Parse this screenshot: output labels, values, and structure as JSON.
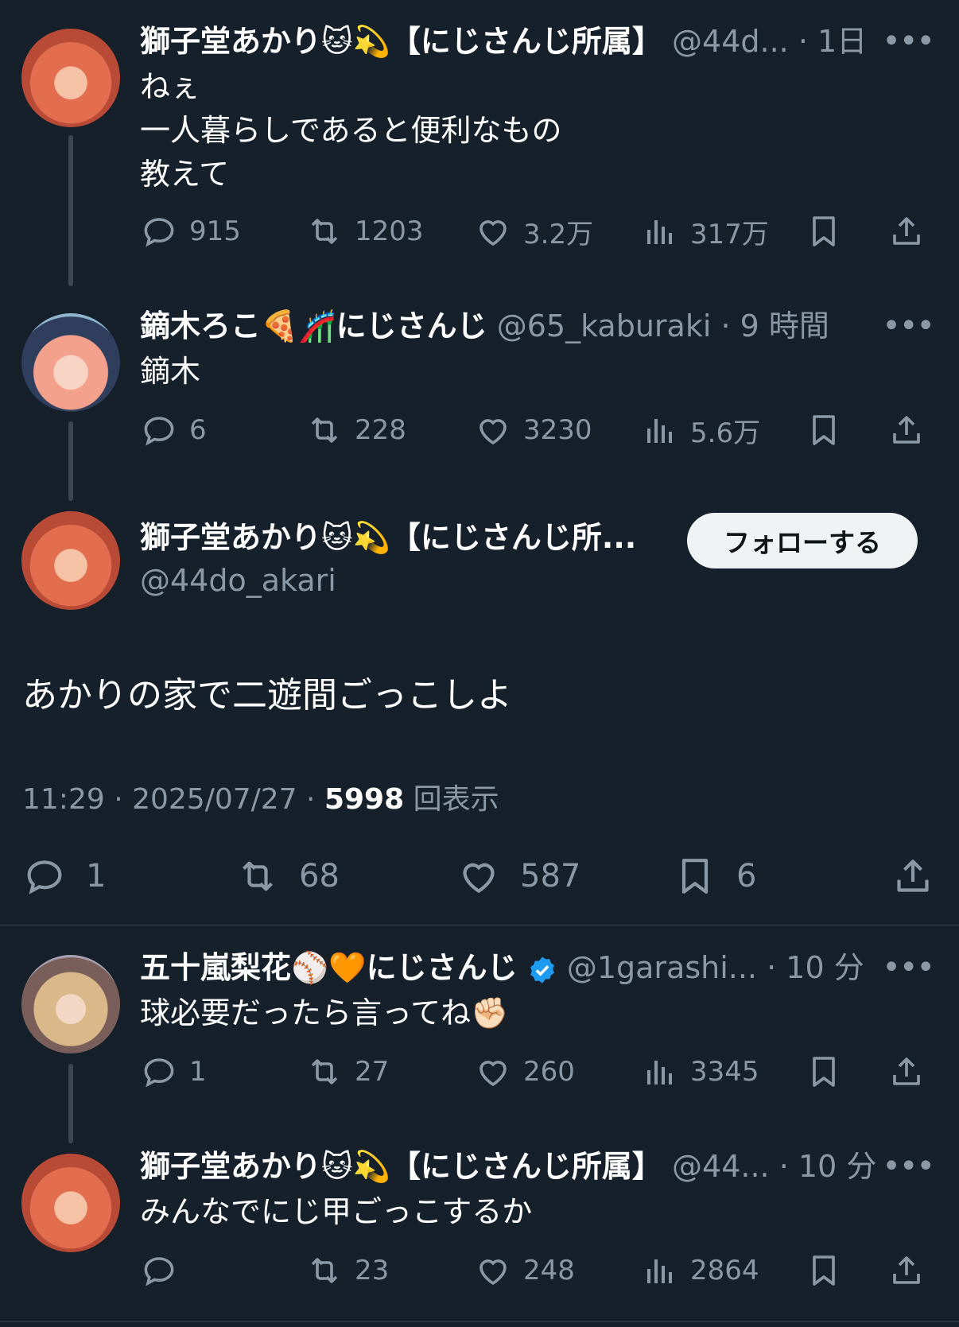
{
  "tweet1": {
    "display_name": "獅子堂あかり🐱💫【にじさんじ所属】",
    "handle": "@44d...",
    "time": "1日",
    "text": "ねぇ\n一人暮らしであると便利なもの\n教えて",
    "replies": "915",
    "retweets": "1203",
    "likes": "3.2万",
    "views": "317万"
  },
  "tweet2": {
    "display_name": "鏑木ろこ🍕🎢にじさんじ",
    "handle": "@65_kaburaki",
    "time": "9 時間",
    "text": "鏑木",
    "replies": "6",
    "retweets": "228",
    "likes": "3230",
    "views": "5.6万"
  },
  "main": {
    "display_name": "獅子堂あかり🐱💫【にじさんじ所...",
    "handle": "@44do_akari",
    "follow_label": "フォローする",
    "text": "あかりの家で二遊間ごっこしよ",
    "time": "11:29",
    "date": "2025/07/27",
    "views_count": "5998",
    "views_label": "回表示",
    "replies": "1",
    "retweets": "68",
    "likes": "587",
    "bookmarks": "6"
  },
  "reply1": {
    "display_name": "五十嵐梨花⚾🧡にじさんじ",
    "handle": "@1garashi...",
    "time": "10 分",
    "text": "球必要だったら言ってね✊🏻",
    "replies": "1",
    "retweets": "27",
    "likes": "260",
    "views": "3345"
  },
  "reply2": {
    "display_name": "獅子堂あかり🐱💫【にじさんじ所属】",
    "handle": "@44...",
    "time": "10 分",
    "text": "みんなでにじ甲ごっこするか",
    "replies": "",
    "retweets": "23",
    "likes": "248",
    "views": "2864"
  },
  "colors": {
    "background": "#15202b",
    "muted": "#8b98a5",
    "verified": "#1d9bf0"
  }
}
